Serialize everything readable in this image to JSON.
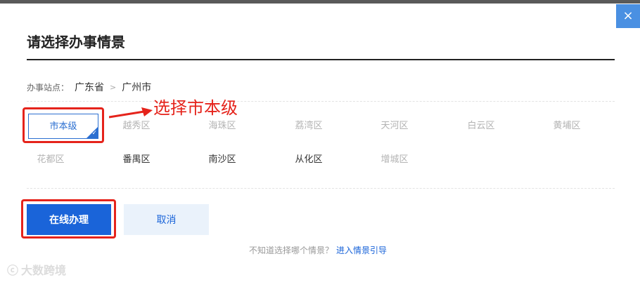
{
  "dialog": {
    "title": "请选择办事情景",
    "close_icon": "×"
  },
  "breadcrumb": {
    "label": "办事站点：",
    "province": "广东省",
    "separator": ">",
    "city": "广州市"
  },
  "districts": {
    "row1": [
      "市本级",
      "越秀区",
      "海珠区",
      "荔湾区",
      "天河区",
      "白云区",
      "黄埔区"
    ],
    "row2": [
      "花都区",
      "番禺区",
      "南沙区",
      "从化区",
      "增城区"
    ]
  },
  "annotation": {
    "text": "选择市本级"
  },
  "buttons": {
    "primary": "在线办理",
    "secondary": "取消"
  },
  "help": {
    "question": "不知道选择哪个情景？",
    "link": "进入情景引导"
  },
  "watermark": {
    "text": "大数跨境"
  },
  "colors": {
    "accent": "#1a64d9",
    "annotation_red": "#e5231b",
    "close_bg": "#4a90e2"
  }
}
